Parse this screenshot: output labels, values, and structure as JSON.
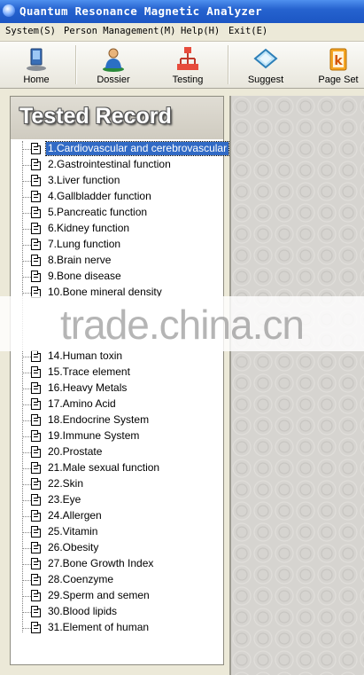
{
  "window": {
    "title": "Quantum Resonance Magnetic Analyzer"
  },
  "menu": [
    {
      "label": "System(S)"
    },
    {
      "label": "Person Management(M)"
    },
    {
      "label": "Help(H)"
    },
    {
      "label": "Exit(E)"
    }
  ],
  "toolbar": [
    {
      "label": "Home",
      "icon": "computer-icon"
    },
    {
      "label": "Dossier",
      "icon": "person-icon"
    },
    {
      "label": "Testing",
      "icon": "network-icon"
    },
    {
      "label": "Suggest",
      "icon": "diamond-icon"
    },
    {
      "label": "Page Set",
      "icon": "page-k-icon"
    }
  ],
  "panel": {
    "header": "Tested Record"
  },
  "records": [
    "1.Cardiovascular and cerebrovascular",
    "2.Gastrointestinal function",
    "3.Liver function",
    "4.Gallbladder function",
    "5.Pancreatic function",
    "6.Kidney function",
    "7.Lung function",
    "8.Brain nerve",
    "9.Bone disease",
    "10.Bone mineral density",
    "",
    "",
    "",
    "14.Human toxin",
    "15.Trace element",
    "16.Heavy Metals",
    "17.Amino Acid",
    "18.Endocrine System",
    "19.Immune System",
    "20.Prostate",
    "21.Male sexual function",
    "22.Skin",
    "23.Eye",
    "24.Allergen",
    "25.Vitamin",
    "26.Obesity",
    "27.Bone Growth Index",
    "28.Coenzyme",
    "29.Sperm and semen",
    "30.Blood lipids",
    "31.Element of human"
  ],
  "selected_index": 0,
  "watermark": "trade.china.cn",
  "colors": {
    "title_bar": "#2663cf",
    "selection": "#316ac5"
  }
}
